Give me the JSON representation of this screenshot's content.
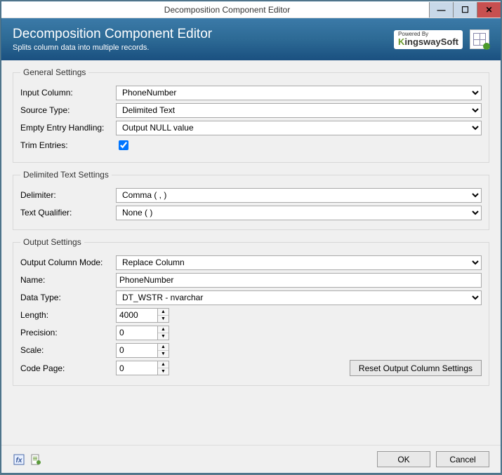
{
  "window": {
    "title": "Decomposition Component Editor"
  },
  "header": {
    "title": "Decomposition Component Editor",
    "subtitle": "Splits column data into multiple records.",
    "logo_powered": "Powered By",
    "logo_name_k": "K",
    "logo_name_rest": "ingswaySoft"
  },
  "sections": {
    "general": {
      "legend": "General Settings",
      "input_column_label": "Input Column:",
      "input_column_value": "PhoneNumber",
      "source_type_label": "Source Type:",
      "source_type_value": "Delimited Text",
      "empty_entry_label": "Empty Entry Handling:",
      "empty_entry_value": "Output NULL value",
      "trim_entries_label": "Trim Entries:",
      "trim_entries_checked": true
    },
    "delimited": {
      "legend": "Delimited Text Settings",
      "delimiter_label": "Delimiter:",
      "delimiter_value": "Comma ( , )",
      "text_qualifier_label": "Text Qualifier:",
      "text_qualifier_value": "None (  )"
    },
    "output": {
      "legend": "Output Settings",
      "mode_label": "Output Column Mode:",
      "mode_value": "Replace Column",
      "name_label": "Name:",
      "name_value": "PhoneNumber",
      "datatype_label": "Data Type:",
      "datatype_value": "DT_WSTR - nvarchar",
      "length_label": "Length:",
      "length_value": "4000",
      "precision_label": "Precision:",
      "precision_value": "0",
      "scale_label": "Scale:",
      "scale_value": "0",
      "codepage_label": "Code Page:",
      "codepage_value": "0",
      "reset_button": "Reset Output Column Settings"
    }
  },
  "footer": {
    "ok": "OK",
    "cancel": "Cancel"
  }
}
